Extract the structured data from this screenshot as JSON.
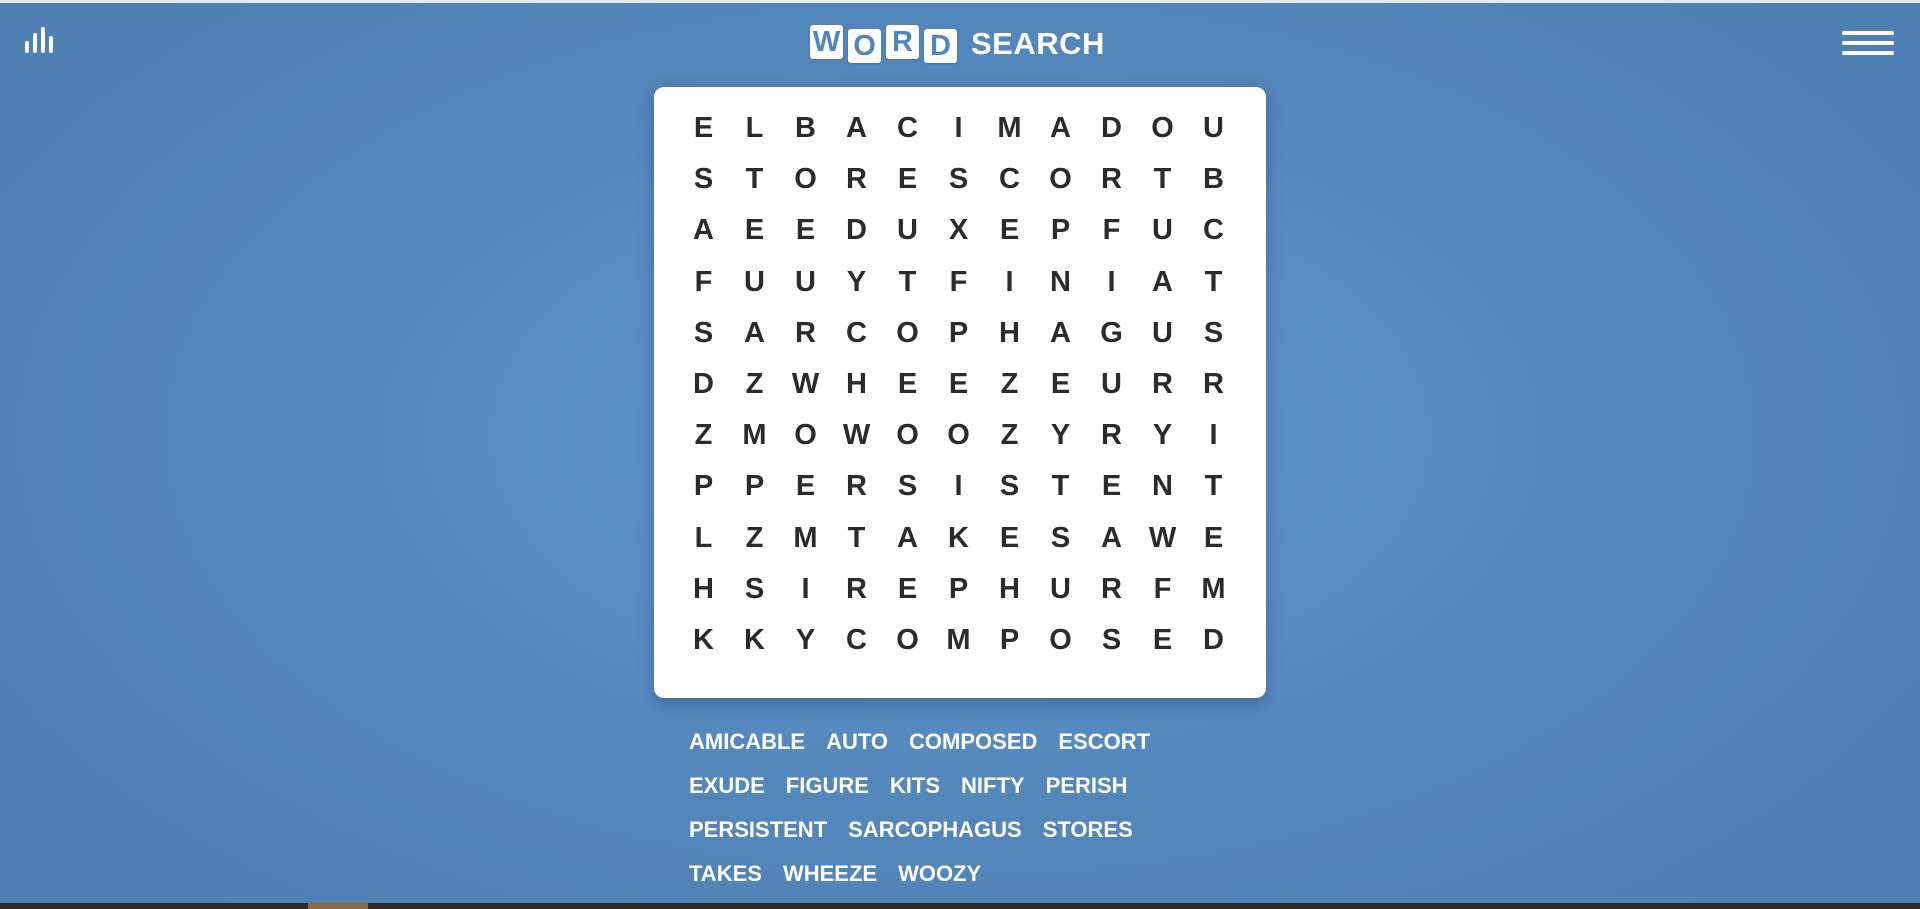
{
  "header": {
    "logo_tiles": [
      "W",
      "O",
      "R",
      "D"
    ],
    "logo_rest": "SEARCH",
    "stats_icon": "bar-chart-icon",
    "menu_icon": "hamburger-menu-icon"
  },
  "colors": {
    "background": "#5a8fc5",
    "board": "#ffffff",
    "letters": "#2b2b2b",
    "word_list_text": "#ffffff"
  },
  "grid": [
    [
      "E",
      "L",
      "B",
      "A",
      "C",
      "I",
      "M",
      "A",
      "D",
      "O",
      "U"
    ],
    [
      "S",
      "T",
      "O",
      "R",
      "E",
      "S",
      "C",
      "O",
      "R",
      "T",
      "B"
    ],
    [
      "A",
      "E",
      "E",
      "D",
      "U",
      "X",
      "E",
      "P",
      "F",
      "U",
      "C"
    ],
    [
      "F",
      "U",
      "U",
      "Y",
      "T",
      "F",
      "I",
      "N",
      "I",
      "A",
      "T"
    ],
    [
      "S",
      "A",
      "R",
      "C",
      "O",
      "P",
      "H",
      "A",
      "G",
      "U",
      "S"
    ],
    [
      "D",
      "Z",
      "W",
      "H",
      "E",
      "E",
      "Z",
      "E",
      "U",
      "R",
      "R"
    ],
    [
      "Z",
      "M",
      "O",
      "W",
      "O",
      "O",
      "Z",
      "Y",
      "R",
      "Y",
      "I"
    ],
    [
      "P",
      "P",
      "E",
      "R",
      "S",
      "I",
      "S",
      "T",
      "E",
      "N",
      "T"
    ],
    [
      "L",
      "Z",
      "M",
      "T",
      "A",
      "K",
      "E",
      "S",
      "A",
      "W",
      "E"
    ],
    [
      "H",
      "S",
      "I",
      "R",
      "E",
      "P",
      "H",
      "U",
      "R",
      "F",
      "M"
    ],
    [
      "K",
      "K",
      "Y",
      "C",
      "O",
      "M",
      "P",
      "O",
      "S",
      "E",
      "D"
    ]
  ],
  "word_rows": [
    [
      "AMICABLE",
      "AUTO",
      "COMPOSED",
      "ESCORT"
    ],
    [
      "EXUDE",
      "FIGURE",
      "KITS",
      "NIFTY",
      "PERISH"
    ],
    [
      "PERSISTENT",
      "SARCOPHAGUS",
      "STORES"
    ],
    [
      "TAKES",
      "WHEEZE",
      "WOOZY"
    ]
  ]
}
